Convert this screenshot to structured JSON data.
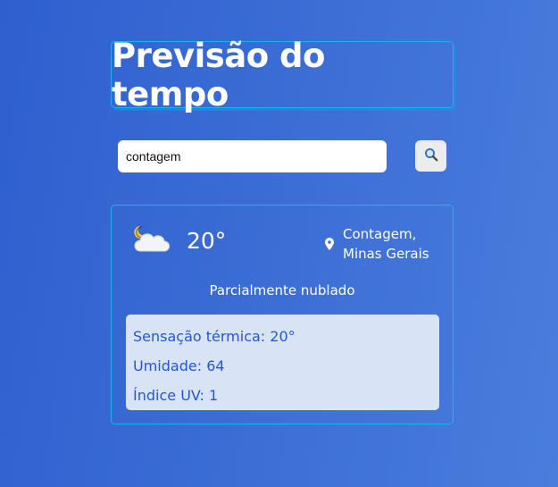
{
  "header": {
    "title": "Previsão do tempo"
  },
  "search": {
    "value": "contagem",
    "button_icon": "search-icon"
  },
  "weather": {
    "icon": "partly-cloudy-night-icon",
    "temperature": "20°",
    "location_line1": "Contagem,",
    "location_line2": "Minas Gerais",
    "condition": "Parcialmente nublado",
    "details": {
      "feels_like_label": "Sensação térmica:",
      "feels_like_value": "20°",
      "humidity_label": "Umidade:",
      "humidity_value": "64",
      "uv_label": "Índice UV:",
      "uv_value": "1"
    }
  },
  "colors": {
    "background_start": "#2f5fcf",
    "background_end": "#4a7ddc",
    "border_accent": "#18b6f0",
    "details_bg": "#d8e3f6",
    "details_text": "#2456d8"
  }
}
